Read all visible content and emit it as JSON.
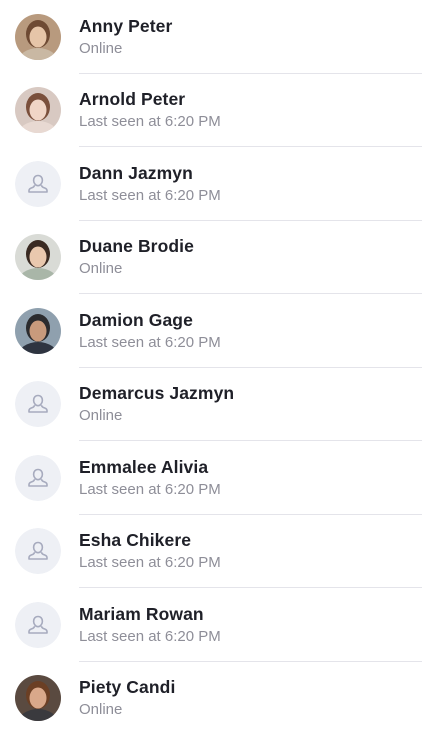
{
  "contacts": [
    {
      "name": "Anny Peter",
      "status": "Online",
      "avatar": "photo",
      "colors": {
        "bg": "#b89a7e",
        "hair": "#6e4a33",
        "skin": "#e6c5a8",
        "cloth": "#c9b8a3"
      }
    },
    {
      "name": "Arnold Peter",
      "status": "Last seen at 6:20 PM",
      "avatar": "photo",
      "colors": {
        "bg": "#d8c9c2",
        "hair": "#7a4f3b",
        "skin": "#f0d5c6",
        "cloth": "#e8d9d2"
      }
    },
    {
      "name": "Dann Jazmyn",
      "status": "Last seen at 6:20 PM",
      "avatar": "placeholder"
    },
    {
      "name": "Duane Brodie",
      "status": "Online",
      "avatar": "photo",
      "colors": {
        "bg": "#d9dbd6",
        "hair": "#3a2a22",
        "skin": "#e9c8ae",
        "cloth": "#a9b6a8"
      }
    },
    {
      "name": "Damion Gage",
      "status": "Last seen at 6:20 PM",
      "avatar": "photo",
      "colors": {
        "bg": "#8fa0ae",
        "hair": "#2b2b2e",
        "skin": "#c89a7c",
        "cloth": "#2e3440"
      }
    },
    {
      "name": "Demarcus Jazmyn",
      "status": "Online",
      "avatar": "placeholder"
    },
    {
      "name": "Emmalee Alivia",
      "status": "Last seen at 6:20 PM",
      "avatar": "placeholder"
    },
    {
      "name": "Esha Chikere",
      "status": "Last seen at 6:20 PM",
      "avatar": "placeholder"
    },
    {
      "name": "Mariam Rowan",
      "status": "Last seen at 6:20 PM",
      "avatar": "placeholder"
    },
    {
      "name": "Piety Candi",
      "status": "Online",
      "avatar": "photo",
      "colors": {
        "bg": "#5a4a40",
        "hair": "#6b3f24",
        "skin": "#d9a88a",
        "cloth": "#3a3a3e"
      }
    }
  ],
  "placeholder_colors": {
    "bg": "#eef0f5",
    "icon": "#a7abbe"
  }
}
